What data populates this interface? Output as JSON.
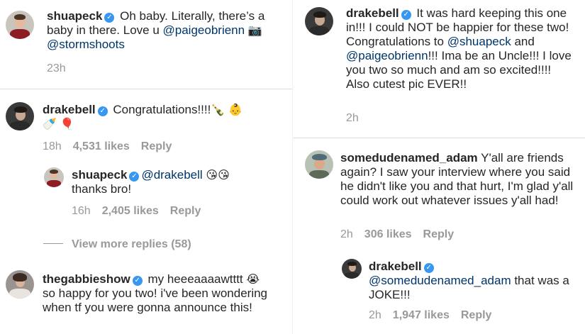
{
  "left": {
    "post": {
      "user": "shuapeck",
      "text_before": " Oh baby. Literally, there’s a baby in there. Love u ",
      "mention1": "@paigeobrienn",
      "mention2": "@stormshoots",
      "time": "23h"
    },
    "comment1": {
      "user": "drakebell",
      "text": " Congratulations!!!!",
      "time": "18h",
      "likes": "4,531 likes",
      "reply": "Reply"
    },
    "reply1": {
      "user": "shuapeck",
      "mention": "@drakebell",
      "text": "thanks bro!",
      "time": "16h",
      "likes": "2,405 likes",
      "reply": "Reply"
    },
    "view_more": "View more replies (58)",
    "comment2": {
      "user": "thegabbieshow",
      "text": " my heeeaaaawtttt",
      "text2": "so happy for you two! i've been wondering when tf you were gonna announce this!"
    }
  },
  "right": {
    "post": {
      "user": "drakebell",
      "text1": " It was hard keeping this one in!!! I could NOT be happier for these two! Congratulations to ",
      "mention1": "@shuapeck",
      "and": " and ",
      "mention2": "@paigeobrienn",
      "text2": "!!! Ima be an Uncle!!! I love you two so much and am so excited!!!! Also cutest pic EVER!!",
      "time": "2h"
    },
    "comment1": {
      "user": "somedudenamed_adam",
      "text": " Y'all are friends again? I saw your interview where you said he didn't like you and that hurt, I'm glad y'all could work out whatever issues y'all had!",
      "time": "2h",
      "likes": "306 likes",
      "reply": "Reply"
    },
    "reply1": {
      "user": "drakebell",
      "mention": "@somedudenamed_adam",
      "text": " that was a JOKE!!!",
      "time": "2h",
      "likes": "1,947 likes",
      "reply": "Reply"
    }
  },
  "emojis": {
    "camera": "📷",
    "bottle": "🍾",
    "baby": "👶",
    "baby_bottle": "🍼",
    "balloon": "🎈",
    "kiss": "😘",
    "crying": "😭"
  },
  "verified_mark": "✓",
  "colors": {
    "mention": "#003569",
    "meta": "#999999",
    "verified": "#3897f0"
  }
}
